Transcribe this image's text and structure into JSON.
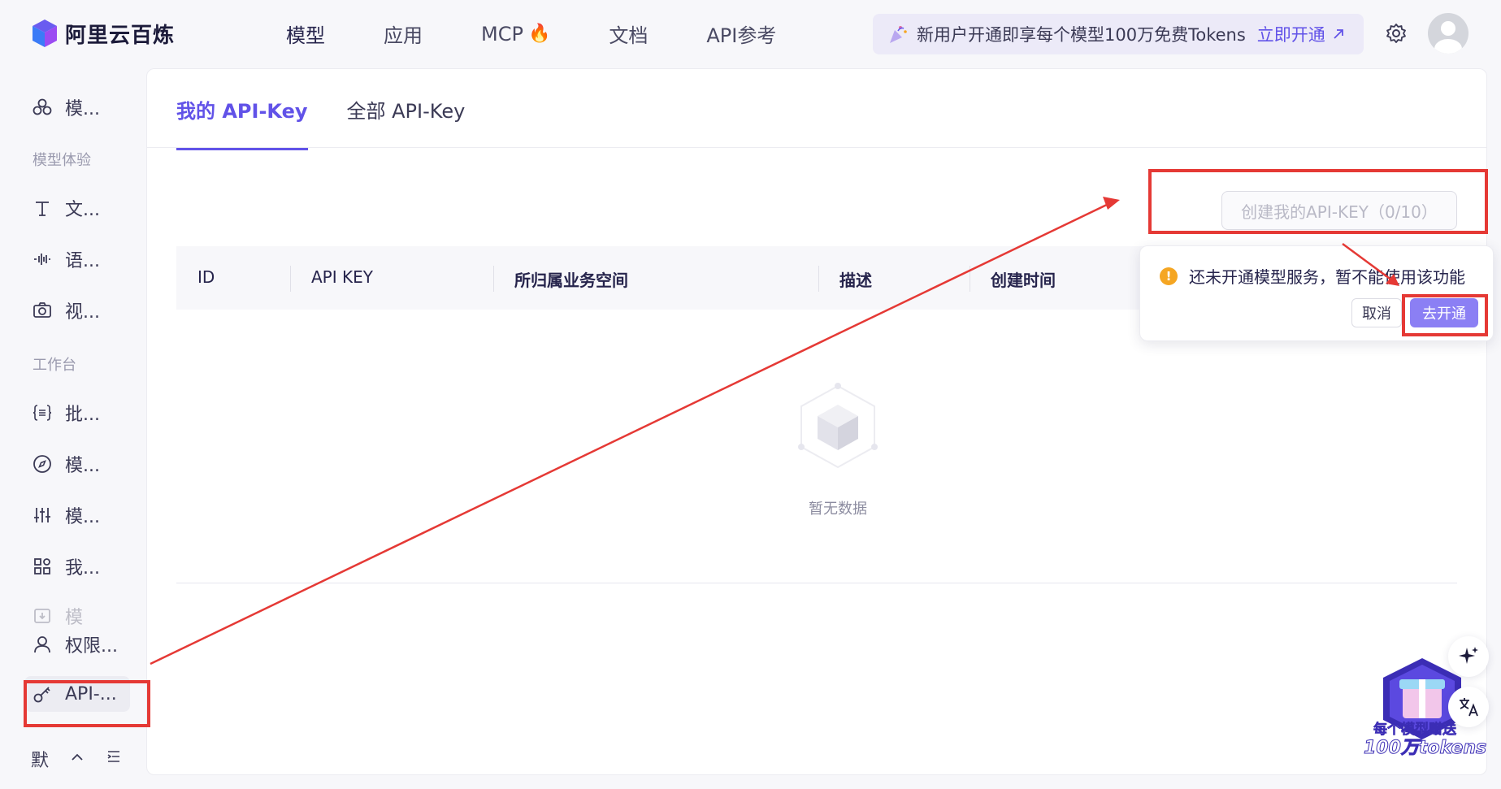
{
  "app": {
    "title": "阿里云百炼"
  },
  "nav": {
    "items": [
      {
        "label": "模型"
      },
      {
        "label": "应用"
      },
      {
        "label": "MCP"
      },
      {
        "label": "文档"
      },
      {
        "label": "API参考"
      }
    ]
  },
  "promo": {
    "text": "新用户开通即享每个模型100万免费Tokens",
    "link": "立即开通"
  },
  "sidebar": {
    "items": [
      {
        "label": "模..."
      },
      {
        "label": "文..."
      },
      {
        "label": "语..."
      },
      {
        "label": "视..."
      },
      {
        "label": "批..."
      },
      {
        "label": "模..."
      },
      {
        "label": "模..."
      },
      {
        "label": "我..."
      },
      {
        "label": "模"
      },
      {
        "label": "权限..."
      },
      {
        "label": "API-..."
      }
    ],
    "groups": [
      "模型体验",
      "工作台"
    ],
    "bottom_label": "默"
  },
  "tabs": [
    {
      "label": "我的 API-Key"
    },
    {
      "label": "全部 API-Key"
    }
  ],
  "create_button": "创建我的API-KEY（0/10）",
  "table": {
    "columns": [
      "ID",
      "API KEY",
      "所归属业务空间",
      "描述",
      "创建时间"
    ],
    "empty_text": "暂无数据"
  },
  "popconfirm": {
    "message": "还未开通模型服务，暂不能使用该功能",
    "cancel": "取消",
    "ok": "去开通"
  },
  "gift": {
    "line1": "每个模型赠送",
    "line2": "100万tokens"
  },
  "colors": {
    "accent": "#6152e8",
    "annotation": "#e53935"
  }
}
